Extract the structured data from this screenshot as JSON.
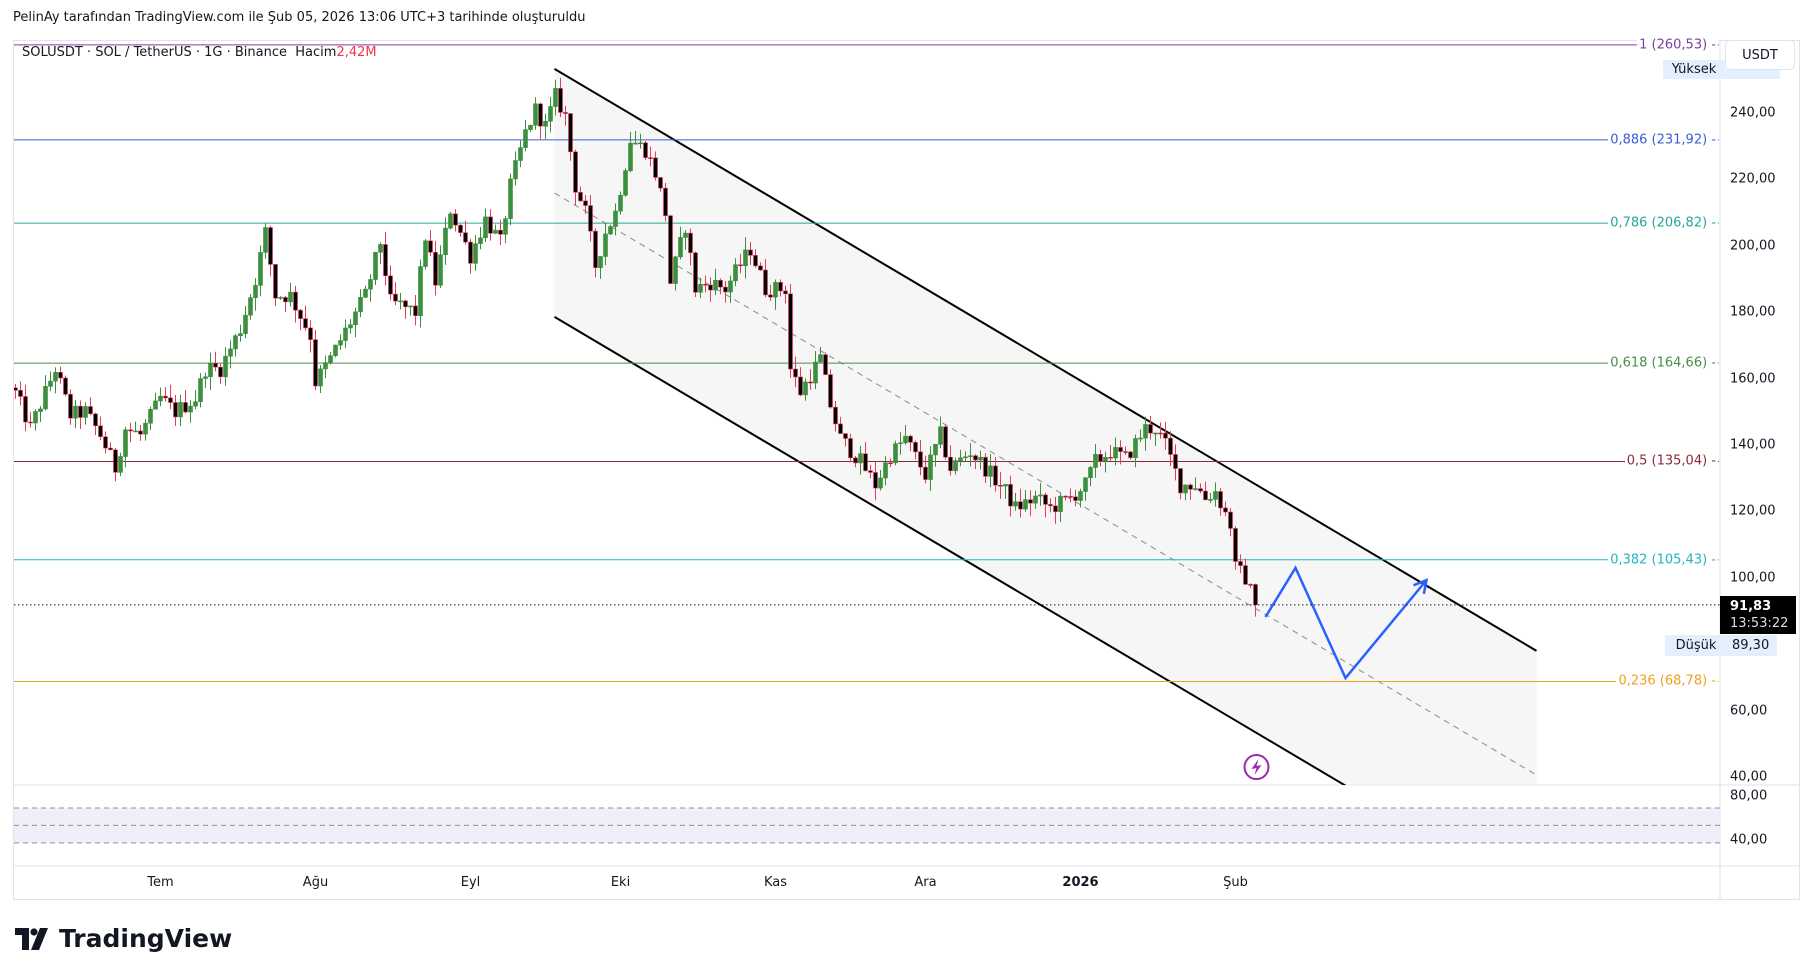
{
  "header": {
    "attribution": "PelinAy tarafından TradingView.com ile Şub 05, 2026 13:06 UTC+3 tarihinde oluşturuldu"
  },
  "legend": {
    "symbol": "SOLUSDT · SOL / TetherUS · 1G · Binance",
    "volume_label": "Hacim",
    "volume_value": "2,42M"
  },
  "price_axis": {
    "currency_button": "USDT",
    "high_label": "Yüksek",
    "low_label": "Düşük",
    "low_value": "89,30",
    "last_price": "91,83",
    "countdown": "13:53:22"
  },
  "indicator_pane": {
    "labels": [
      {
        "value": 80,
        "text": "80,00"
      },
      {
        "value": 40,
        "text": "40,00"
      }
    ]
  },
  "branding": {
    "logo_text": "TradingView"
  },
  "colors": {
    "up": "#3b8f3e",
    "down_body": "#000000",
    "down_wick": "#e0405a",
    "channel": "#000000",
    "projection": "#2962ff"
  },
  "chart_data": {
    "type": "candlestick",
    "title": "SOLUSDT · SOL / TetherUS · 1G · Binance",
    "ylabel": "USDT",
    "ylim": [
      40,
      260
    ],
    "y_ticks": [
      {
        "v": 240,
        "t": "240,00"
      },
      {
        "v": 220,
        "t": "220,00"
      },
      {
        "v": 200,
        "t": "200,00"
      },
      {
        "v": 180,
        "t": "180,00"
      },
      {
        "v": 160,
        "t": "160,00"
      },
      {
        "v": 140,
        "t": "140,00"
      },
      {
        "v": 120,
        "t": "120,00"
      },
      {
        "v": 100,
        "t": "100,00"
      },
      {
        "v": 60,
        "t": "60,00"
      },
      {
        "v": 40,
        "t": "40,00"
      }
    ],
    "x_ticks": [
      {
        "day": 29,
        "t": "Tem"
      },
      {
        "day": 60,
        "t": "Ağu"
      },
      {
        "day": 91,
        "t": "Eyl"
      },
      {
        "day": 121,
        "t": "Eki"
      },
      {
        "day": 152,
        "t": "Kas"
      },
      {
        "day": 182,
        "t": "Ara"
      },
      {
        "day": 213,
        "t": "2026",
        "bold": true
      },
      {
        "day": 244,
        "t": "Şub"
      }
    ],
    "candle_count": 249,
    "close_path": [
      [
        0,
        155.7
      ],
      [
        3,
        145
      ],
      [
        8,
        163
      ],
      [
        11,
        149
      ],
      [
        14,
        150
      ],
      [
        17,
        143
      ],
      [
        20,
        133
      ],
      [
        22,
        145
      ],
      [
        25,
        143
      ],
      [
        29,
        154
      ],
      [
        32,
        150
      ],
      [
        36,
        154
      ],
      [
        38,
        163
      ],
      [
        41,
        163
      ],
      [
        45,
        175
      ],
      [
        48,
        190
      ],
      [
        50,
        204
      ],
      [
        52,
        185
      ],
      [
        55,
        185
      ],
      [
        59,
        173
      ],
      [
        60,
        159
      ],
      [
        63,
        166
      ],
      [
        67,
        177
      ],
      [
        70,
        185
      ],
      [
        73,
        201
      ],
      [
        75,
        183
      ],
      [
        77,
        182
      ],
      [
        80,
        180
      ],
      [
        82,
        203
      ],
      [
        84,
        189
      ],
      [
        87,
        211
      ],
      [
        89,
        204
      ],
      [
        91,
        197
      ],
      [
        94,
        208
      ],
      [
        97,
        201
      ],
      [
        99,
        218
      ],
      [
        102,
        234
      ],
      [
        104,
        241
      ],
      [
        106,
        236
      ],
      [
        108,
        245
      ],
      [
        110,
        239
      ],
      [
        112,
        218
      ],
      [
        114,
        210
      ],
      [
        116,
        194
      ],
      [
        118,
        204
      ],
      [
        120,
        210
      ],
      [
        123,
        232
      ],
      [
        126,
        229
      ],
      [
        128,
        222
      ],
      [
        130,
        210
      ],
      [
        131,
        189
      ],
      [
        134,
        206
      ],
      [
        136,
        187
      ],
      [
        139,
        189
      ],
      [
        142,
        187
      ],
      [
        144,
        192
      ],
      [
        147,
        199
      ],
      [
        150,
        187
      ],
      [
        154,
        187
      ],
      [
        155,
        163
      ],
      [
        157,
        156
      ],
      [
        161,
        166
      ],
      [
        163,
        152
      ],
      [
        165,
        142
      ],
      [
        169,
        135
      ],
      [
        172,
        128
      ],
      [
        175,
        137
      ],
      [
        178,
        142
      ],
      [
        182,
        131
      ],
      [
        185,
        143
      ],
      [
        187,
        133
      ],
      [
        191,
        138
      ],
      [
        194,
        133
      ],
      [
        198,
        126
      ],
      [
        200,
        121
      ],
      [
        204,
        124
      ],
      [
        207,
        121
      ],
      [
        211,
        124
      ],
      [
        214,
        128
      ],
      [
        216,
        135
      ],
      [
        219,
        138
      ],
      [
        222,
        136
      ],
      [
        226,
        145
      ],
      [
        228,
        145
      ],
      [
        230,
        140
      ],
      [
        233,
        128
      ],
      [
        236,
        128
      ],
      [
        238,
        124
      ],
      [
        240,
        126
      ],
      [
        243,
        116
      ],
      [
        244,
        103
      ],
      [
        246,
        100
      ],
      [
        248,
        91.83
      ]
    ],
    "last_close": 91.83,
    "high": 260.53,
    "low": 89.3,
    "fibonacci": [
      {
        "level": "1",
        "price": 260.53,
        "label": "1 (260,53)",
        "color": "#7b3fa0"
      },
      {
        "level": "0.886",
        "price": 231.92,
        "label": "0,886 (231,92)",
        "color": "#3d5bd6"
      },
      {
        "level": "0.786",
        "price": 206.82,
        "label": "0,786 (206,82)",
        "color": "#26a69a"
      },
      {
        "level": "0.618",
        "price": 164.66,
        "label": "0,618 (164,66)",
        "color": "#4c8c4a"
      },
      {
        "level": "0.5",
        "price": 135.04,
        "label": "0,5 (135,04)",
        "color": "#8b2a3a"
      },
      {
        "level": "0.382",
        "price": 105.43,
        "label": "0,382 (105,43)",
        "color": "#22b5c5"
      },
      {
        "level": "0.236",
        "price": 68.78,
        "label": "0,236 (68,78)",
        "color": "#f0a020"
      }
    ],
    "channel": {
      "upper": [
        [
          107.8,
          253.3
        ],
        [
          304.2,
          78
        ]
      ],
      "lower": [
        [
          107.8,
          178.6
        ],
        [
          304.2,
          3.3
        ]
      ],
      "middle": [
        [
          107.8,
          215.9
        ],
        [
          304.2,
          40.6
        ]
      ]
    },
    "projection_path": [
      [
        250,
        88.2
      ],
      [
        256,
        103
      ],
      [
        266,
        69.8
      ],
      [
        282.2,
        99.3
      ]
    ],
    "event_marker": {
      "day": 248.2,
      "price": 43,
      "icon": "lightning-icon"
    },
    "indicator_levels": [
      70,
      50,
      30
    ]
  }
}
